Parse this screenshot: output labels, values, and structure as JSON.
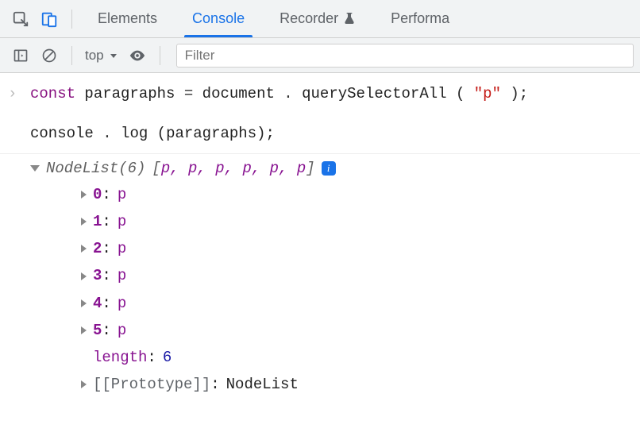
{
  "toolbar": {
    "tabs": [
      "Elements",
      "Console",
      "Recorder",
      "Performa"
    ],
    "active_tab_index": 1
  },
  "subtoolbar": {
    "context_label": "top",
    "filter_placeholder": "Filter"
  },
  "console": {
    "input_line1_kw": "const",
    "input_line1_ident": "paragraphs",
    "input_line1_op": " = ",
    "input_line1_obj": "document",
    "input_line1_dot": ".",
    "input_line1_fn": "querySelectorAll",
    "input_line1_paren_open": " (",
    "input_line1_str": "\"p\"",
    "input_line1_paren_close": ");",
    "input_line2_obj": "console",
    "input_line2_dot": ".",
    "input_line2_fn": "log",
    "input_line2_arg": "(paragraphs);",
    "nodelist_type": "NodeList(6)",
    "nodelist_open": "[",
    "nodelist_tags": "p, p, p, p, p, p",
    "nodelist_close": "]",
    "info_badge": "i",
    "items": [
      {
        "idx": "0",
        "val": "p"
      },
      {
        "idx": "1",
        "val": "p"
      },
      {
        "idx": "2",
        "val": "p"
      },
      {
        "idx": "3",
        "val": "p"
      },
      {
        "idx": "4",
        "val": "p"
      },
      {
        "idx": "5",
        "val": "p"
      }
    ],
    "length_key": "length",
    "length_val": "6",
    "proto_key": "[[Prototype]]",
    "proto_val": "NodeList"
  }
}
